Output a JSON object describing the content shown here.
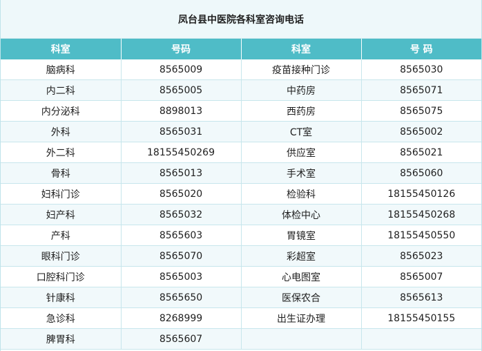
{
  "title": "凤台县中医院各科室咨询电话",
  "headers": [
    "科室",
    "号码",
    "科室",
    "号 码"
  ],
  "rows": [
    [
      "脑病科",
      "8565009",
      "疫苗接种门诊",
      "8565030"
    ],
    [
      "内二科",
      "8565005",
      "中药房",
      "8565071"
    ],
    [
      "内分泌科",
      "8898013",
      "西药房",
      "8565075"
    ],
    [
      "外科",
      "8565031",
      "CT室",
      "8565002"
    ],
    [
      "外二科",
      "18155450269",
      "供应室",
      "8565021"
    ],
    [
      "骨科",
      "8565013",
      "手术室",
      "8565060"
    ],
    [
      "妇科门诊",
      "8565020",
      "检验科",
      "18155450126"
    ],
    [
      "妇产科",
      "8565032",
      "体检中心",
      "18155450268"
    ],
    [
      "产科",
      "8565603",
      "胃镜室",
      "18155450550"
    ],
    [
      "眼科门诊",
      "8565070",
      "彩超室",
      "8565023"
    ],
    [
      "口腔科门诊",
      "8565003",
      "心电图室",
      "8565007"
    ],
    [
      "针康科",
      "8565650",
      "医保农合",
      "8565613"
    ],
    [
      "急诊科",
      "8268999",
      "出生证办理",
      "18155450155"
    ],
    [
      "脾胃科",
      "8565607",
      "",
      ""
    ]
  ]
}
